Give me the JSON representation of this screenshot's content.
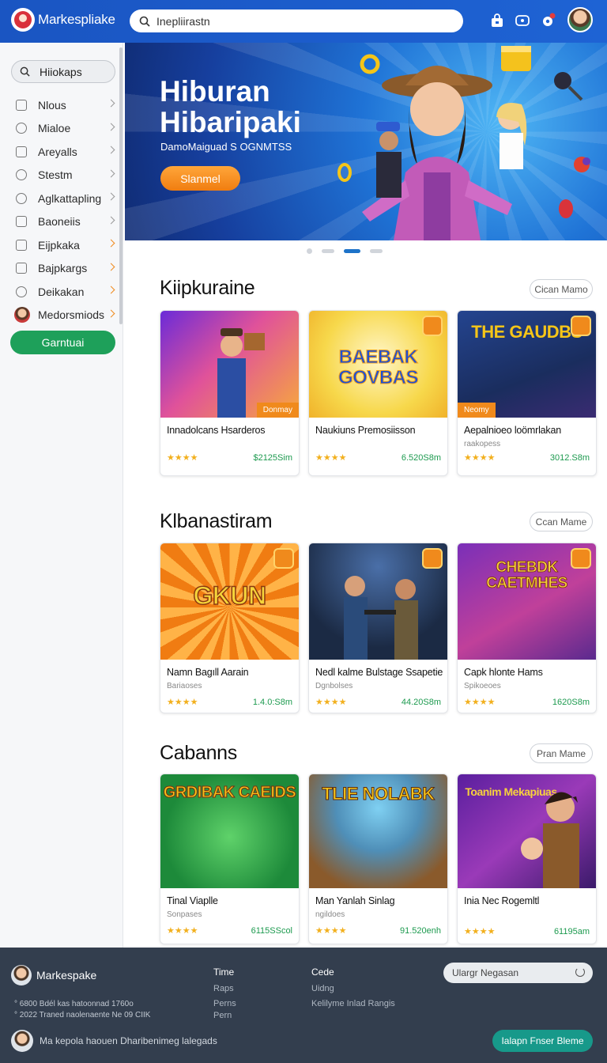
{
  "header": {
    "logo_text": "Markespliake",
    "search_value": "Inepliirastn",
    "icons": [
      "store-icon",
      "chat-icon",
      "notifications-icon"
    ],
    "accent_color": "#1e63d4"
  },
  "sidebar": {
    "search_label": "Hiiokaps",
    "items": [
      {
        "label": "Nlous",
        "icon": "square-icon"
      },
      {
        "label": "Mialoe",
        "icon": "user-icon"
      },
      {
        "label": "Areyalls",
        "icon": "tag-icon"
      },
      {
        "label": "Stestm",
        "icon": "search-icon"
      },
      {
        "label": "Aglkattapling",
        "icon": "person-icon"
      },
      {
        "label": "Baoneiis",
        "icon": "grid-icon"
      },
      {
        "label": "Eijpkaka",
        "icon": "document-icon"
      },
      {
        "label": "Bajpkargs",
        "icon": "bag-icon"
      },
      {
        "label": "Deikakan",
        "icon": "cloud-icon"
      },
      {
        "label": "Medorsmiods",
        "icon": "avatar-icon"
      }
    ],
    "cta_label": "Garntuai"
  },
  "hero": {
    "title": "Hiburan Hibaripaki",
    "subtitle": "DamoMaiguad S OGNMTSS",
    "button_label": "Slanmel",
    "slides_total": 4,
    "slide_active": 3
  },
  "sections": [
    {
      "title": "Kiipkuraine",
      "pill_label": "Cican Mamo",
      "cards": [
        {
          "title": "Innadolcans Hsarderos",
          "subtitle": "",
          "stars": "★★★★",
          "price": "$2125Sim",
          "badge": "Donmay",
          "art": "",
          "rating": 4
        },
        {
          "title": "Naukiuns Premosiisson",
          "subtitle": "",
          "stars": "★★★★",
          "price": "6.520S8m",
          "badge": "",
          "art": "BAEBAK GOVBAS",
          "rating": 4
        },
        {
          "title": "Aepalnioeo loömrlakan",
          "subtitle": "raakopess",
          "stars": "★★★★",
          "price": "3012.S8m",
          "badge": "Neomy",
          "art": "THE GAUDBS",
          "rating": 4
        }
      ]
    },
    {
      "title": "Klbanastiram",
      "pill_label": "Ccan Mame",
      "cards": [
        {
          "title": "Namn Bagıll Aarain",
          "subtitle": "Bariaoses",
          "stars": "★★★★",
          "price": "1.4.0:S8m",
          "badge": "",
          "art": "GKUN",
          "rating": 4
        },
        {
          "title": "Nedl kalme Bulstage Ssapetie",
          "subtitle": "Dgnbolses",
          "stars": "★★★★",
          "price": "44.20S8m",
          "badge": "",
          "art": "",
          "rating": 4
        },
        {
          "title": "Capk hlonte Hams",
          "subtitle": "Spikoeoes",
          "stars": "★★★★",
          "price": "1620S8m",
          "badge": "",
          "art": "CHEBDK CAETMHES",
          "rating": 4
        }
      ]
    },
    {
      "title": "Cabanns",
      "pill_label": "Pran Mame",
      "cards": [
        {
          "title": "Tinal Viaplle",
          "subtitle": "Sonpases",
          "stars": "★★★★",
          "price": "6115SScol",
          "badge": "",
          "art": "GRDIBAK CAEIDS",
          "rating": 4
        },
        {
          "title": "Man Yanlah Sinlag",
          "subtitle": "ngildoes",
          "stars": "★★★★",
          "price": "91.520enh",
          "badge": "",
          "art": "TLIE NOLABK",
          "rating": 4
        },
        {
          "title": "Inia Nec Rogemltl",
          "subtitle": "",
          "stars": "★★★★",
          "price": "61195am",
          "badge": "",
          "art": "Toanim Mekapiuas",
          "rating": 4
        }
      ]
    }
  ],
  "footer": {
    "logo_text": "Markespake",
    "line1": "° 6800 Bdél kas hatoonnad 1760o",
    "line2": "° 2022 Traned naolenaente Ne 09 CIIK",
    "col1_head": "Time",
    "col1_links": [
      "Raps",
      "Perns",
      "Pern"
    ],
    "col2_head": "Cede",
    "col2_links": [
      "Uidng",
      "Kelilyme Inlad Rangis"
    ],
    "search_placeholder": "Ulargr Negasan",
    "bottom_text": "Ma kepola haouen Dharibenimeg lalegads",
    "cta_label": "Ialapn Fnser Bleme",
    "bg_color": "#333e4e"
  }
}
